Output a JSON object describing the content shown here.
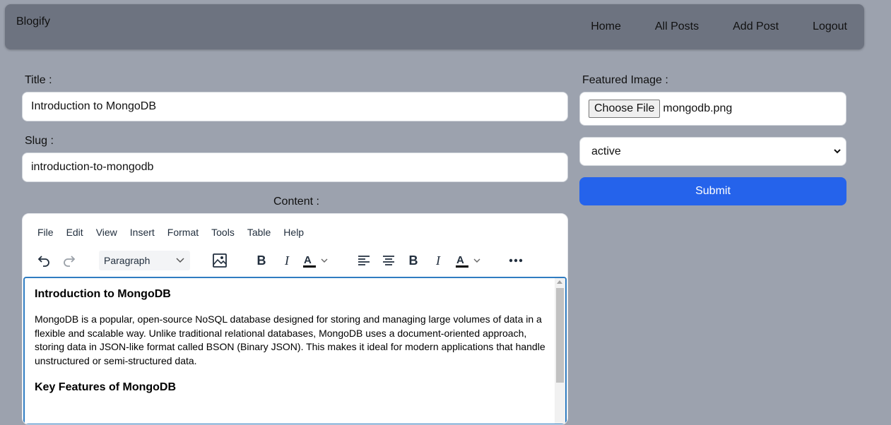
{
  "navbar": {
    "brand": "Blogify",
    "links": [
      "Home",
      "All Posts",
      "Add Post",
      "Logout"
    ]
  },
  "form": {
    "title_label": "Title :",
    "title_value": "Introduction to MongoDB",
    "slug_label": "Slug :",
    "slug_value": "introduction-to-mongodb",
    "content_label": "Content :",
    "featured_label": "Featured Image :",
    "choose_file_label": "Choose File",
    "file_name": "mongodb.png",
    "status_value": "active",
    "submit_label": "Submit"
  },
  "editor": {
    "menu": [
      "File",
      "Edit",
      "View",
      "Insert",
      "Format",
      "Tools",
      "Table",
      "Help"
    ],
    "block_format": "Paragraph",
    "toolbar_icons": [
      "undo-icon",
      "redo-icon",
      "image-icon",
      "bold-icon",
      "italic-icon",
      "text-color-icon",
      "align-left-icon",
      "align-center-icon",
      "bold-icon",
      "italic-icon",
      "text-color-icon",
      "more-icon"
    ],
    "content": {
      "heading1": "Introduction to MongoDB",
      "paragraph1": "MongoDB is a popular, open-source NoSQL database designed for storing and managing large volumes of data in a flexible and scalable way. Unlike traditional relational databases, MongoDB uses a document-oriented approach, storing data in JSON-like format called BSON (Binary JSON). This makes it ideal for modern applications that handle unstructured or semi-structured data.",
      "heading2": "Key Features of MongoDB"
    }
  },
  "colors": {
    "page_bg": "#9ca2ae",
    "navbar_bg": "#6d7380",
    "submit_bg": "#2563eb",
    "editor_focus": "#2f7cc1"
  }
}
